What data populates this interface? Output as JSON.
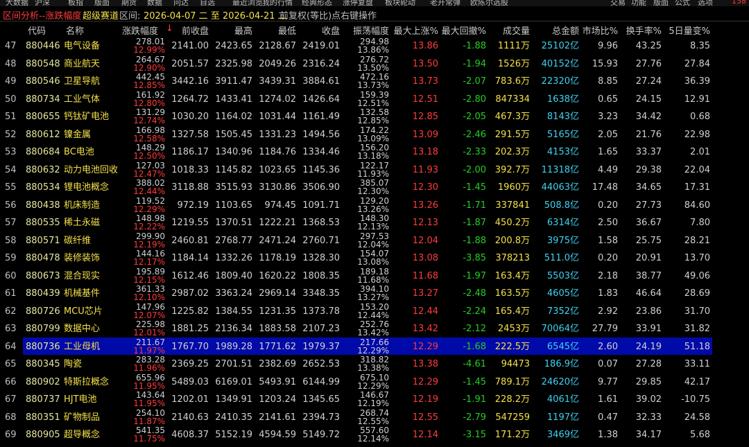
{
  "menubar": {
    "items": [
      "大数据",
      "沪深",
      "板指",
      "版面",
      "期货",
      "数据",
      "问达",
      "自选",
      "最近浏览",
      "我的行情",
      "经典形态",
      "涨停复盘",
      "板块轮动",
      "老开常弹",
      "欧陈尔选股"
    ],
    "right_items": [
      "交易",
      "功能",
      "版面",
      "公式",
      "选项"
    ],
    "account": "158"
  },
  "titlebar": {
    "prefix": "区间分析--涨跌幅度",
    "channel": "超级赛道",
    "range_label": "区间:",
    "range_value": "2026-04-07 二 至 2026-04-21 二",
    "adjust": "前复权(等比)",
    "hint": "点右键操作"
  },
  "columns": [
    "代码",
    "名称",
    "涨跌幅度",
    "前收盘",
    "最高",
    "最低",
    "收盘",
    "振荡幅度",
    "最大上涨%",
    "最大回撤%",
    "成交量",
    "总金额",
    "市场比%",
    "换手率%",
    "5日量变%"
  ],
  "sort_indicator": "↓",
  "selected_row": 64,
  "rows": [
    {
      "idx": "47",
      "code": "880446",
      "name": "电气设备",
      "chg": "278.01",
      "chg_pct": "12.99%",
      "prev": "2141.00",
      "high": "2423.65",
      "low": "2128.67",
      "close": "2419.01",
      "amp": "294.98",
      "amp_pct": "13.86%",
      "max_up": "13.86",
      "max_dd": "-1.88",
      "vol": "1111万",
      "amount": "25102亿",
      "share": "9.96",
      "turnover": "43.25",
      "vol5": "8.35"
    },
    {
      "idx": "48",
      "code": "880548",
      "name": "商业航天",
      "chg": "264.67",
      "chg_pct": "12.90%",
      "prev": "2051.57",
      "high": "2325.98",
      "low": "2049.26",
      "close": "2316.24",
      "amp": "276.72",
      "amp_pct": "13.50%",
      "max_up": "13.50",
      "max_dd": "-1.94",
      "vol": "1526万",
      "amount": "40152亿",
      "share": "15.93",
      "turnover": "27.76",
      "vol5": "27.84"
    },
    {
      "idx": "49",
      "code": "880546",
      "name": "卫星导航",
      "chg": "442.45",
      "chg_pct": "12.85%",
      "prev": "3442.16",
      "high": "3911.47",
      "low": "3439.31",
      "close": "3884.61",
      "amp": "472.16",
      "amp_pct": "13.73%",
      "max_up": "13.73",
      "max_dd": "-2.07",
      "vol": "783.6万",
      "amount": "22320亿",
      "share": "8.85",
      "turnover": "27.24",
      "vol5": "36.39"
    },
    {
      "idx": "50",
      "code": "880734",
      "name": "工业气体",
      "chg": "161.92",
      "chg_pct": "12.80%",
      "prev": "1264.72",
      "high": "1433.41",
      "low": "1274.02",
      "close": "1426.64",
      "amp": "159.39",
      "amp_pct": "12.51%",
      "max_up": "12.51",
      "max_dd": "-2.80",
      "vol": "847334",
      "amount": "1638亿",
      "share": "0.65",
      "turnover": "24.15",
      "vol5": "12.91"
    },
    {
      "idx": "51",
      "code": "880655",
      "name": "钙钛矿电池",
      "chg": "131.29",
      "chg_pct": "12.74%",
      "prev": "1030.20",
      "high": "1164.02",
      "low": "1031.44",
      "close": "1161.49",
      "amp": "132.58",
      "amp_pct": "12.85%",
      "max_up": "12.85",
      "max_dd": "-2.05",
      "vol": "467.3万",
      "amount": "8143亿",
      "share": "3.23",
      "turnover": "34.42",
      "vol5": "0.68"
    },
    {
      "idx": "52",
      "code": "880612",
      "name": "镍金属",
      "chg": "166.98",
      "chg_pct": "12.58%",
      "prev": "1327.58",
      "high": "1505.45",
      "low": "1331.23",
      "close": "1494.56",
      "amp": "174.22",
      "amp_pct": "13.09%",
      "max_up": "13.09",
      "max_dd": "-2.46",
      "vol": "291.5万",
      "amount": "5165亿",
      "share": "2.05",
      "turnover": "21.76",
      "vol5": "22.98"
    },
    {
      "idx": "53",
      "code": "880684",
      "name": "BC电池",
      "chg": "148.29",
      "chg_pct": "12.50%",
      "prev": "1186.17",
      "high": "1340.96",
      "low": "1184.76",
      "close": "1334.46",
      "amp": "156.20",
      "amp_pct": "13.18%",
      "max_up": "13.18",
      "max_dd": "-2.33",
      "vol": "202.3万",
      "amount": "4153亿",
      "share": "1.65",
      "turnover": "33.37",
      "vol5": "2.01"
    },
    {
      "idx": "54",
      "code": "880632",
      "name": "动力电池回收",
      "chg": "127.03",
      "chg_pct": "12.47%",
      "prev": "1018.33",
      "high": "1145.82",
      "low": "1023.65",
      "close": "1145.36",
      "amp": "122.17",
      "amp_pct": "11.93%",
      "max_up": "11.93",
      "max_dd": "-2.00",
      "vol": "392.7万",
      "amount": "11318亿",
      "share": "4.49",
      "turnover": "29.38",
      "vol5": "22.04"
    },
    {
      "idx": "55",
      "code": "880534",
      "name": "锂电池概念",
      "chg": "388.02",
      "chg_pct": "12.44%",
      "prev": "3118.88",
      "high": "3515.93",
      "low": "3130.86",
      "close": "3506.90",
      "amp": "385.07",
      "amp_pct": "12.30%",
      "max_up": "12.30",
      "max_dd": "-1.45",
      "vol": "1960万",
      "amount": "44063亿",
      "share": "17.48",
      "turnover": "34.65",
      "vol5": "17.31"
    },
    {
      "idx": "56",
      "code": "880438",
      "name": "机床制造",
      "chg": "119.52",
      "chg_pct": "12.29%",
      "prev": "972.19",
      "high": "1103.65",
      "low": "974.45",
      "close": "1091.71",
      "amp": "129.20",
      "amp_pct": "13.26%",
      "max_up": "13.26",
      "max_dd": "-1.71",
      "vol": "337841",
      "amount": "508.8亿",
      "share": "0.20",
      "turnover": "27.73",
      "vol5": "84.60"
    },
    {
      "idx": "57",
      "code": "880535",
      "name": "稀土永磁",
      "chg": "148.98",
      "chg_pct": "12.22%",
      "prev": "1219.55",
      "high": "1370.51",
      "low": "1222.21",
      "close": "1368.53",
      "amp": "148.30",
      "amp_pct": "12.13%",
      "max_up": "12.13",
      "max_dd": "-1.87",
      "vol": "450.2万",
      "amount": "6314亿",
      "share": "2.50",
      "turnover": "36.67",
      "vol5": "7.80"
    },
    {
      "idx": "58",
      "code": "880571",
      "name": "碳纤维",
      "chg": "299.90",
      "chg_pct": "12.19%",
      "prev": "2460.81",
      "high": "2768.77",
      "low": "2471.24",
      "close": "2760.71",
      "amp": "297.53",
      "amp_pct": "12.04%",
      "max_up": "12.04",
      "max_dd": "-1.88",
      "vol": "200.8万",
      "amount": "3975亿",
      "share": "1.58",
      "turnover": "25.75",
      "vol5": "28.21"
    },
    {
      "idx": "59",
      "code": "880478",
      "name": "装修装饰",
      "chg": "144.16",
      "chg_pct": "12.17%",
      "prev": "1184.14",
      "high": "1332.26",
      "low": "1178.19",
      "close": "1328.30",
      "amp": "154.07",
      "amp_pct": "13.08%",
      "max_up": "13.08",
      "max_dd": "-3.85",
      "vol": "378213",
      "amount": "511.0亿",
      "share": "0.20",
      "turnover": "20.91",
      "vol5": "13.70"
    },
    {
      "idx": "60",
      "code": "880673",
      "name": "混合现实",
      "chg": "195.89",
      "chg_pct": "12.15%",
      "prev": "1612.46",
      "high": "1809.40",
      "low": "1620.22",
      "close": "1808.35",
      "amp": "189.18",
      "amp_pct": "11.68%",
      "max_up": "11.68",
      "max_dd": "-1.97",
      "vol": "163.4万",
      "amount": "5503亿",
      "share": "2.18",
      "turnover": "38.77",
      "vol5": "49.06"
    },
    {
      "idx": "61",
      "code": "880439",
      "name": "机械基件",
      "chg": "361.33",
      "chg_pct": "12.10%",
      "prev": "2987.02",
      "high": "3363.24",
      "low": "2969.14",
      "close": "3348.35",
      "amp": "394.10",
      "amp_pct": "13.27%",
      "max_up": "13.27",
      "max_dd": "-2.48",
      "vol": "163.5万",
      "amount": "4605亿",
      "share": "1.83",
      "turnover": "46.64",
      "vol5": "28.69"
    },
    {
      "idx": "62",
      "code": "880726",
      "name": "MCU芯片",
      "chg": "147.96",
      "chg_pct": "12.07%",
      "prev": "1225.82",
      "high": "1384.55",
      "low": "1231.35",
      "close": "1373.78",
      "amp": "153.20",
      "amp_pct": "12.44%",
      "max_up": "12.44",
      "max_dd": "-2.24",
      "vol": "165.4万",
      "amount": "7352亿",
      "share": "2.92",
      "turnover": "23.86",
      "vol5": "31.70"
    },
    {
      "idx": "63",
      "code": "880799",
      "name": "数据中心",
      "chg": "225.98",
      "chg_pct": "12.01%",
      "prev": "1881.25",
      "high": "2136.34",
      "low": "1883.58",
      "close": "2107.23",
      "amp": "252.76",
      "amp_pct": "13.42%",
      "max_up": "13.42",
      "max_dd": "-2.12",
      "vol": "2453万",
      "amount": "70064亿",
      "share": "27.79",
      "turnover": "33.91",
      "vol5": "31.82"
    },
    {
      "idx": "64",
      "code": "880736",
      "name": "工业母机",
      "chg": "211.67",
      "chg_pct": "11.97%",
      "prev": "1767.70",
      "high": "1989.28",
      "low": "1771.62",
      "close": "1979.37",
      "amp": "217.66",
      "amp_pct": "12.29%",
      "max_up": "12.29",
      "max_dd": "-1.68",
      "vol": "222.5万",
      "amount": "6545亿",
      "share": "2.60",
      "turnover": "24.19",
      "vol5": "51.18"
    },
    {
      "idx": "65",
      "code": "880345",
      "name": "陶瓷",
      "chg": "283.28",
      "chg_pct": "11.96%",
      "prev": "2369.25",
      "high": "2701.51",
      "low": "2382.69",
      "close": "2652.53",
      "amp": "318.82",
      "amp_pct": "13.38%",
      "max_up": "13.38",
      "max_dd": "-4.61",
      "vol": "94473",
      "amount": "186.9亿",
      "share": "0.07",
      "turnover": "27.28",
      "vol5": "33.11"
    },
    {
      "idx": "66",
      "code": "880902",
      "name": "特斯拉概念",
      "chg": "655.96",
      "chg_pct": "11.95%",
      "prev": "5489.03",
      "high": "6169.01",
      "low": "5493.91",
      "close": "6144.99",
      "amp": "675.10",
      "amp_pct": "12.29%",
      "max_up": "12.29",
      "max_dd": "-1.45",
      "vol": "789.1万",
      "amount": "24620亿",
      "share": "9.77",
      "turnover": "29.85",
      "vol5": "42.17"
    },
    {
      "idx": "67",
      "code": "880737",
      "name": "HJT电池",
      "chg": "143.64",
      "chg_pct": "11.95%",
      "prev": "1202.01",
      "high": "1349.91",
      "low": "1203.24",
      "close": "1345.65",
      "amp": "146.67",
      "amp_pct": "12.19%",
      "max_up": "12.19",
      "max_dd": "-1.91",
      "vol": "228.2万",
      "amount": "4061亿",
      "share": "1.61",
      "turnover": "39.02",
      "vol5": "-10.75"
    },
    {
      "idx": "68",
      "code": "880351",
      "name": "矿物制品",
      "chg": "254.10",
      "chg_pct": "11.87%",
      "prev": "2140.63",
      "high": "2410.35",
      "low": "2141.61",
      "close": "2394.73",
      "amp": "268.74",
      "amp_pct": "12.55%",
      "max_up": "12.55",
      "max_dd": "-2.79",
      "vol": "547259",
      "amount": "1197亿",
      "share": "0.47",
      "turnover": "32.33",
      "vol5": "24.58"
    },
    {
      "idx": "69",
      "code": "880905",
      "name": "超导概念",
      "chg": "541.35",
      "chg_pct": "11.75%",
      "prev": "4608.37",
      "high": "5152.19",
      "low": "4594.59",
      "close": "5149.72",
      "amp": "557.60",
      "amp_pct": "12.14%",
      "max_up": "12.14",
      "max_dd": "-3.15",
      "vol": "171.2万",
      "amount": "3469亿",
      "share": "1.38",
      "turnover": "34.17",
      "vol5": "5.68"
    }
  ]
}
